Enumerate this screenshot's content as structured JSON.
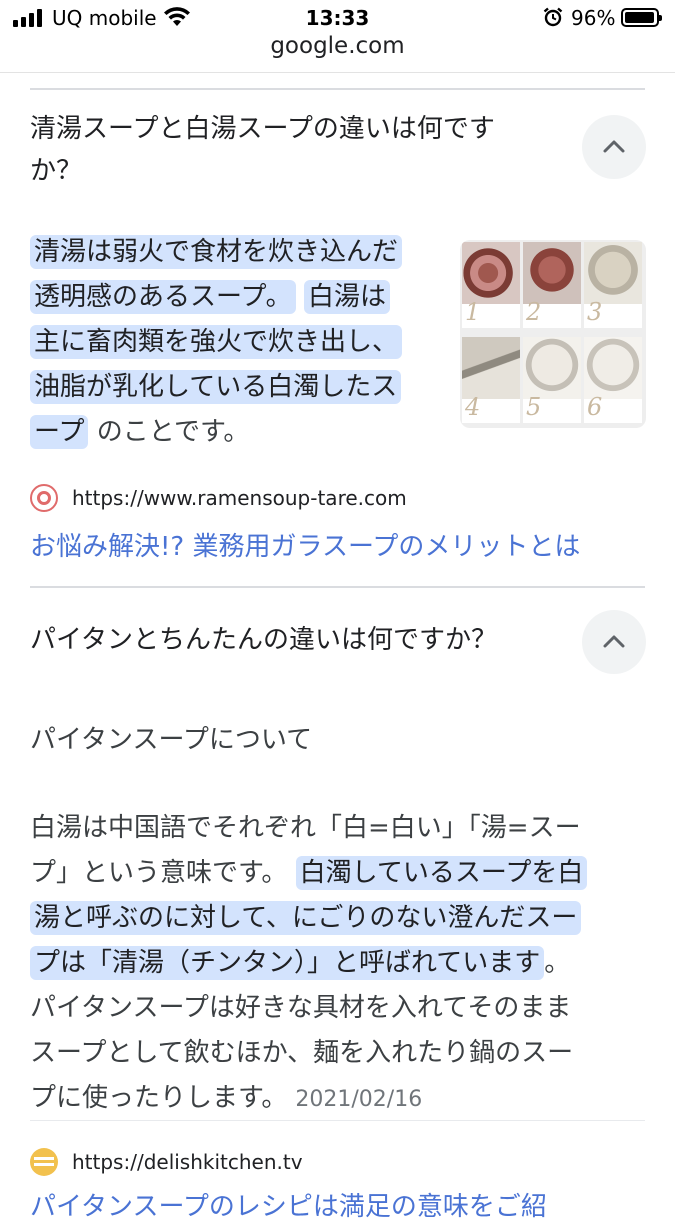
{
  "status_bar": {
    "carrier": "UQ mobile",
    "time": "13:33",
    "battery": "96%",
    "battery_level": 0.96
  },
  "address_bar": {
    "url": "google.com"
  },
  "faq": [
    {
      "question_line1": "清湯スープと白湯スープの違いは何です",
      "question_line2": "か？",
      "answer_highlight": [
        "清湯は弱火で食材を炊き込んだ",
        "透明感のあるスープ。",
        "白湯は",
        "主に畜肉類を強火で炊き出し、",
        "油脂が乳化している白濁したス",
        "ープ"
      ],
      "answer_tail": "のことです。",
      "thumbnail_steps": [
        "1",
        "2",
        "3",
        "4",
        "5",
        "6"
      ],
      "source_url": "https://www.ramensoup-tare.com",
      "link_text": "お悩み解決!? 業務用ガラスープのメリットとは"
    },
    {
      "question": "パイタンとちんたんの違いは何ですか？",
      "answer_title": "パイタンスープについて",
      "body_line1": "白湯は中国語でそれぞれ「白=白い」「湯=スー",
      "body_line2_plain": "プ」という意味です。",
      "body_highlight": [
        "白濁しているスープを白",
        "湯と呼ぶのに対して、にごりのない澄んだスー",
        "プは「清湯（チンタン）」と呼ばれています"
      ],
      "body_after_highlight": "。",
      "body_line5": "パイタンスープは好きな具材を入れてそのまま",
      "body_line6": "スープとして飲むほか、麺を入れたり鍋のスー",
      "body_line7": "プに使ったりします。",
      "date": "2021/02/16",
      "source_url": "https://delishkitchen.tv",
      "link_text": "パイタンスープのレシピは満足の意味をご紹"
    }
  ],
  "colors": {
    "highlight": "#d3e3fd",
    "link": "#4a73d4",
    "divider": "#dadce0",
    "chevron_bg": "#f1f3f4"
  },
  "icons": [
    "signal-icon",
    "wifi-icon",
    "alarm-icon",
    "battery-icon",
    "chevron-up-icon",
    "site-favicon"
  ]
}
